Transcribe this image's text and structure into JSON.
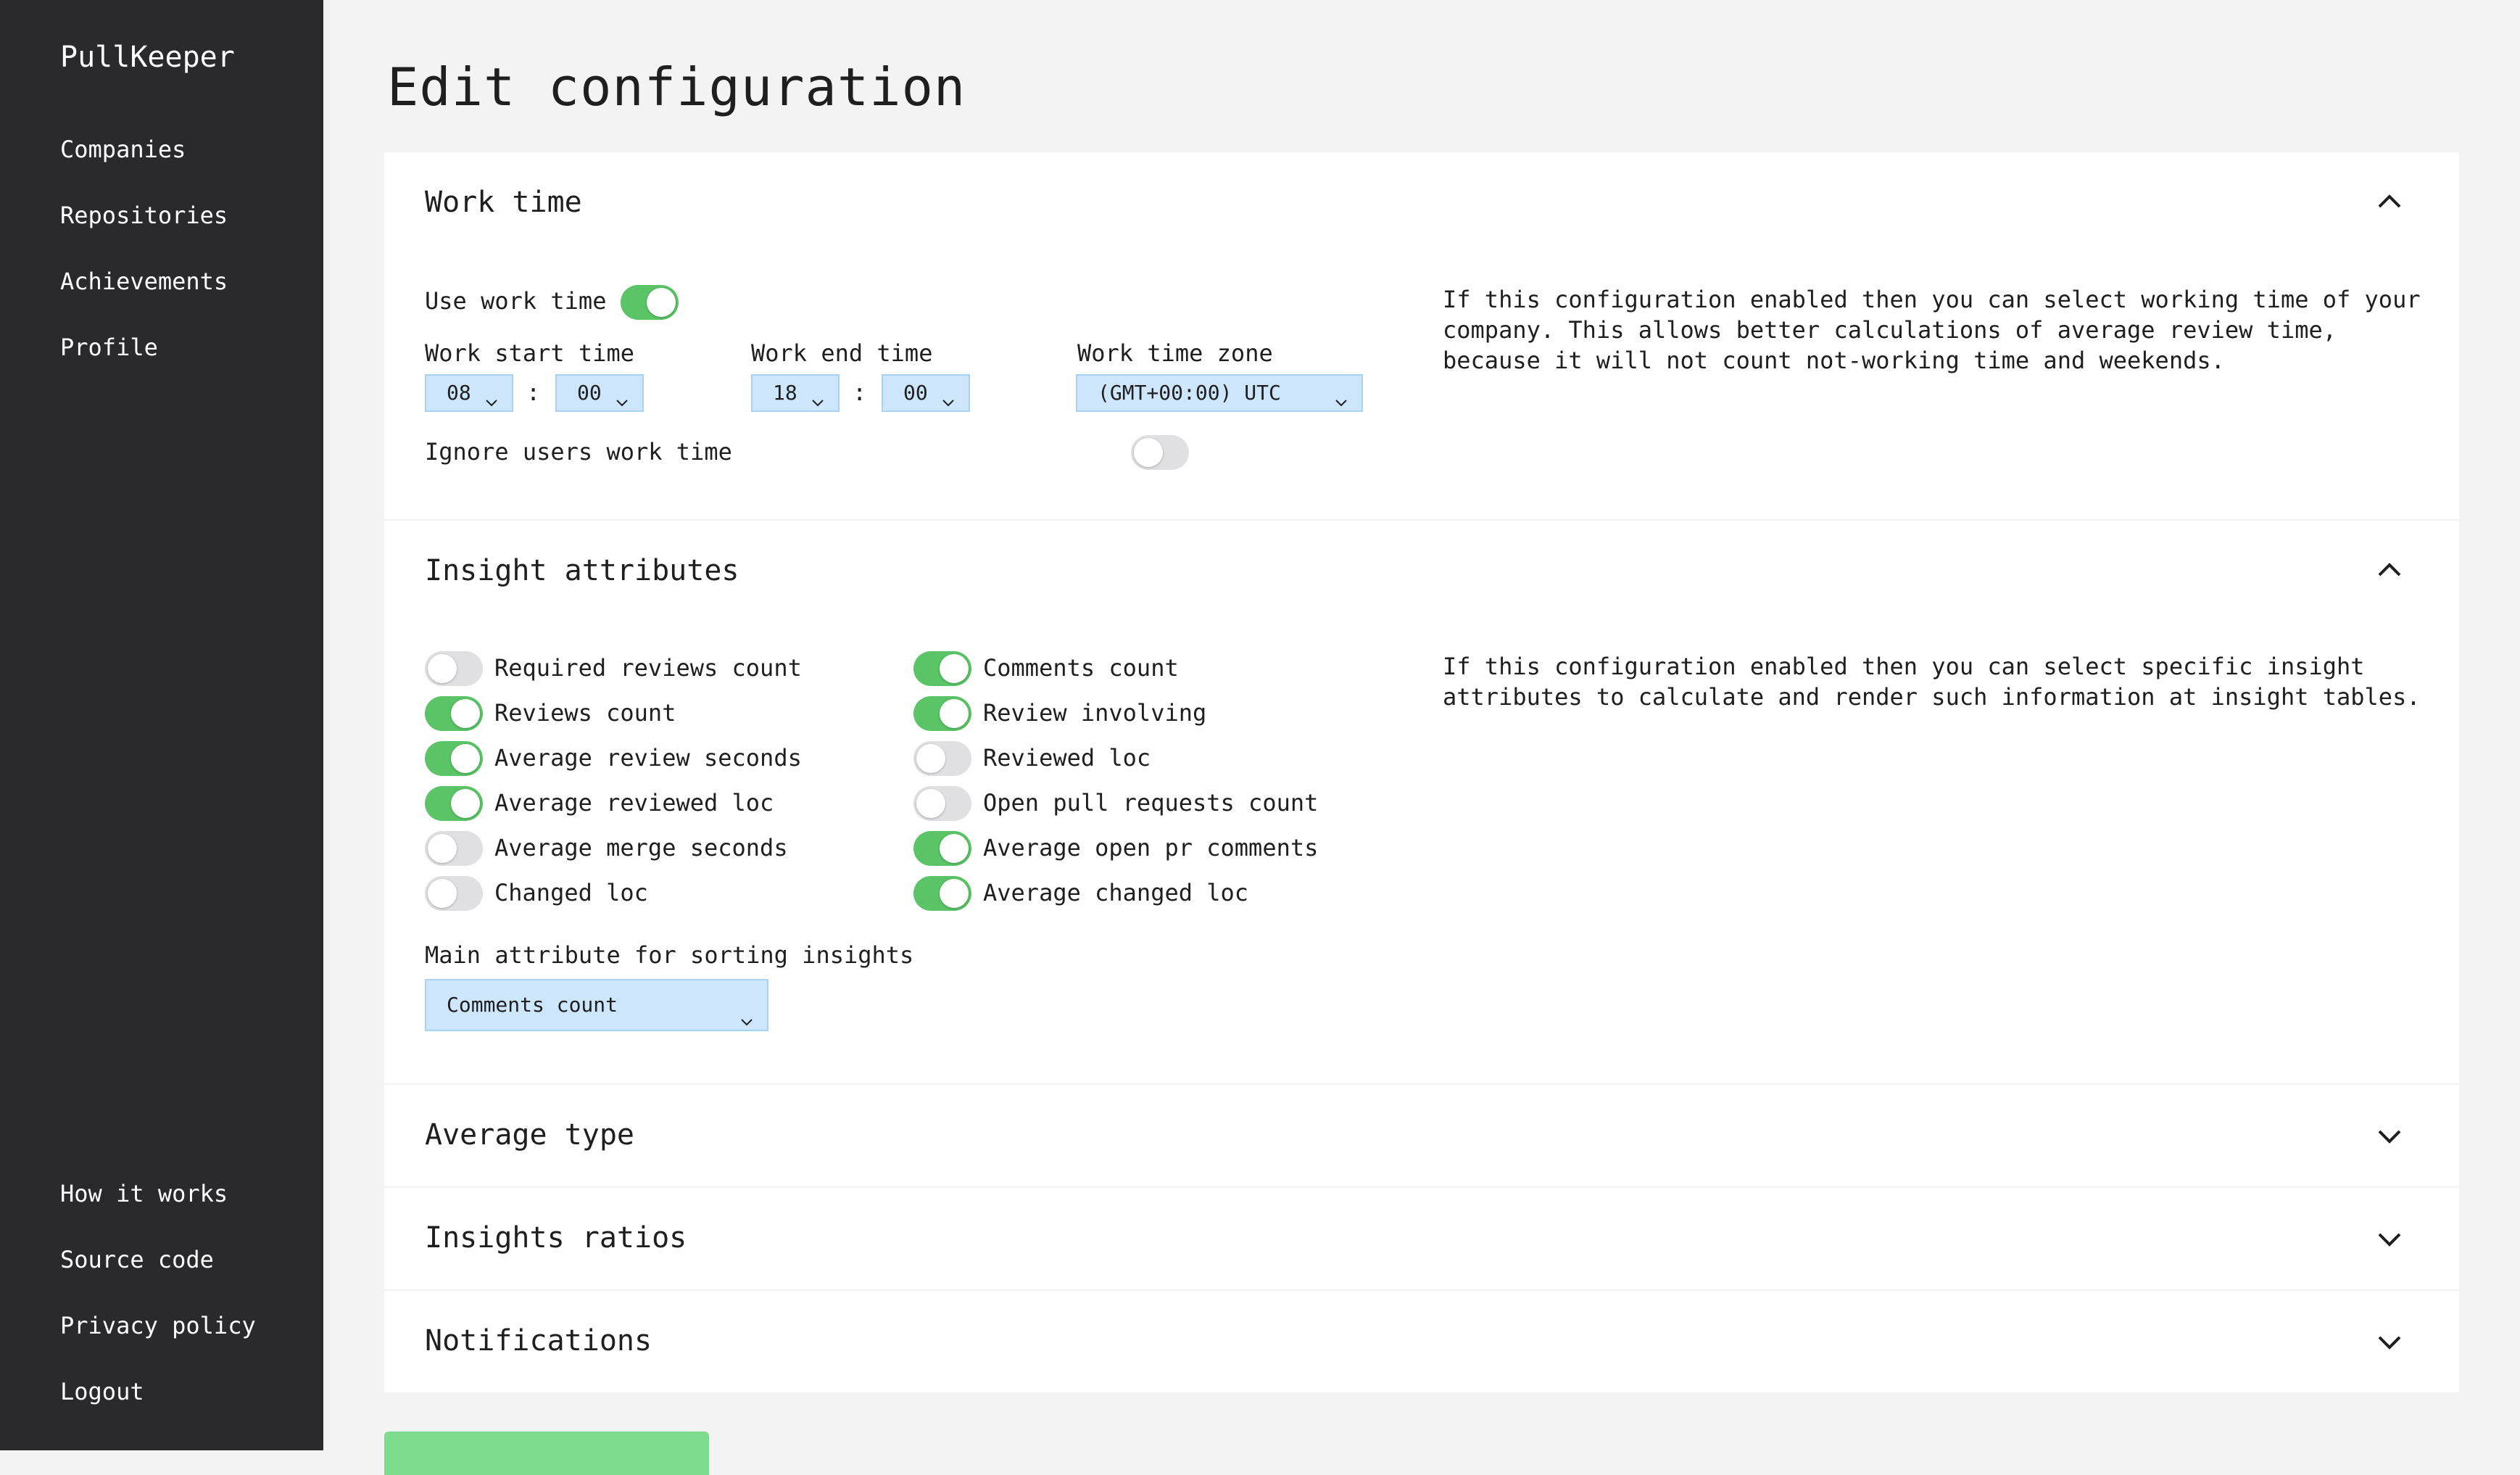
{
  "app": {
    "name": "PullKeeper"
  },
  "sidebar": {
    "top_items": [
      {
        "label": "Companies"
      },
      {
        "label": "Repositories"
      },
      {
        "label": "Achievements"
      },
      {
        "label": "Profile"
      }
    ],
    "bottom_items": [
      {
        "label": "How it works"
      },
      {
        "label": "Source code"
      },
      {
        "label": "Privacy policy"
      },
      {
        "label": "Logout"
      }
    ]
  },
  "page": {
    "title": "Edit configuration"
  },
  "work_time": {
    "title": "Work time",
    "expanded": true,
    "use_work_time_label": "Use work time",
    "use_work_time_on": true,
    "start_label": "Work start time",
    "start_hour": "08",
    "start_minute": "00",
    "end_label": "Work end time",
    "end_hour": "18",
    "end_minute": "00",
    "separator": ":",
    "zone_label": "Work time zone",
    "zone_value": "(GMT+00:00) UTC",
    "ignore_label": "Ignore users work time",
    "ignore_on": false,
    "description": "If this configuration enabled then you can select working time of your company. This allows better calculations of average review time, because it will not count not-working time and weekends."
  },
  "insight_attributes": {
    "title": "Insight attributes",
    "expanded": true,
    "left": [
      {
        "label": "Required reviews count",
        "on": false
      },
      {
        "label": "Reviews count",
        "on": true
      },
      {
        "label": "Average review seconds",
        "on": true
      },
      {
        "label": "Average reviewed loc",
        "on": true
      },
      {
        "label": "Average merge seconds",
        "on": false
      },
      {
        "label": "Changed loc",
        "on": false
      }
    ],
    "right": [
      {
        "label": "Comments count",
        "on": true
      },
      {
        "label": "Review involving",
        "on": true
      },
      {
        "label": "Reviewed loc",
        "on": false
      },
      {
        "label": "Open pull requests count",
        "on": false
      },
      {
        "label": "Average open pr comments",
        "on": true
      },
      {
        "label": "Average changed loc",
        "on": true
      }
    ],
    "sort_label": "Main attribute for sorting insights",
    "sort_value": "Comments count",
    "description": "If this configuration enabled then you can select specific insight attributes to calculate and render such information at insight tables."
  },
  "collapsed_sections": [
    {
      "title": "Average type"
    },
    {
      "title": "Insights ratios"
    },
    {
      "title": "Notifications"
    }
  ],
  "colors": {
    "sidebar_bg": "#2a2a2c",
    "toggle_on": "#5ac466",
    "toggle_off": "#e0e0e3",
    "select_bg": "#cde6fb",
    "save_button": "#7ddc8e"
  }
}
